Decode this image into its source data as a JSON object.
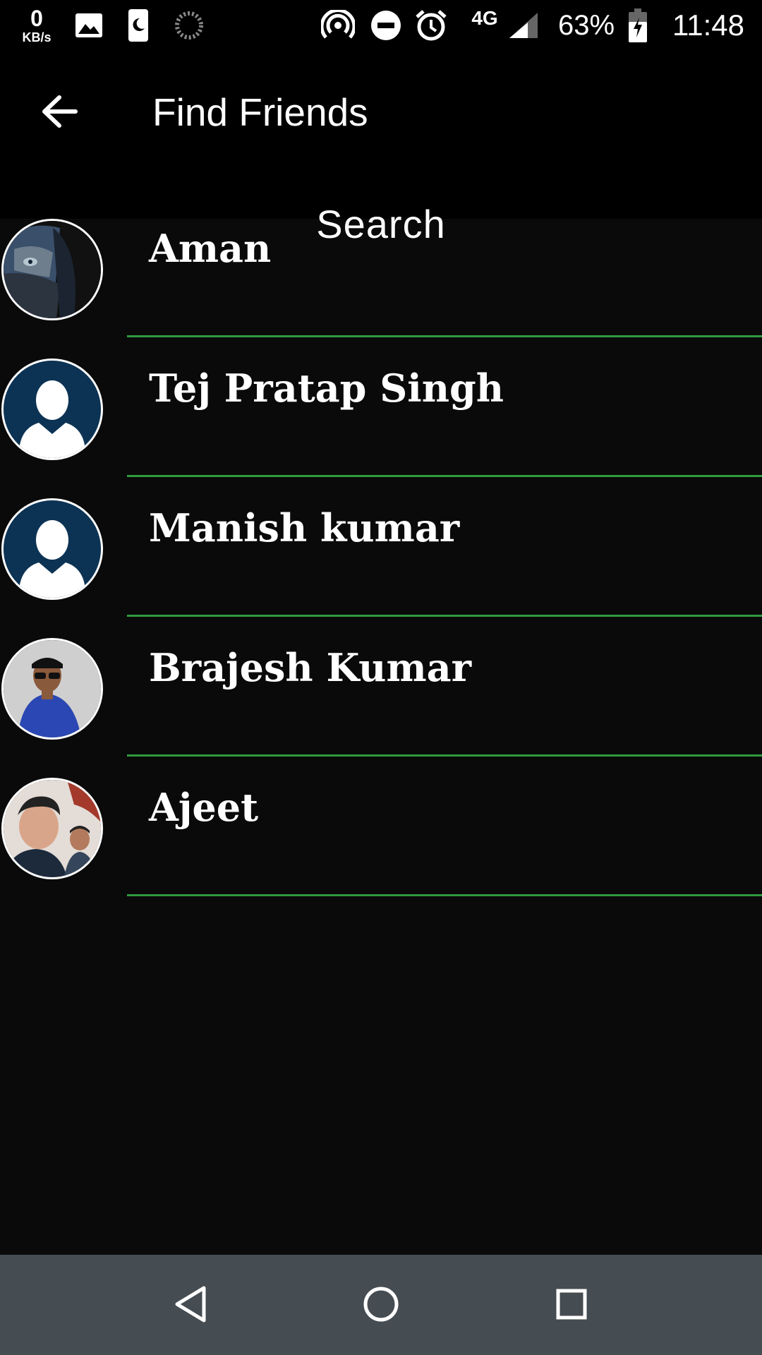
{
  "status_bar": {
    "net_speed_value": "0",
    "net_speed_unit": "KB/s",
    "network": "4G",
    "battery": "63%",
    "time": "11:48",
    "icons": [
      "image-icon",
      "sim-icon",
      "loading-icon",
      "hotspot-icon",
      "dnd-icon",
      "alarm-icon",
      "signal-icon",
      "battery-icon"
    ]
  },
  "toolbar": {
    "back_icon": "arrow-left-icon",
    "title": "Find Friends"
  },
  "search": {
    "label": "Search"
  },
  "friends": [
    {
      "name": "Aman",
      "avatar": "photo-masked-face"
    },
    {
      "name": "Tej Pratap Singh",
      "avatar": "default-user-silhouette"
    },
    {
      "name": "Manish kumar",
      "avatar": "default-user-silhouette"
    },
    {
      "name": "Brajesh Kumar",
      "avatar": "photo-man-cap-sunglasses"
    },
    {
      "name": "Ajeet",
      "avatar": "photo-two-men-selfie"
    }
  ],
  "colors": {
    "background": "#0a0a0a",
    "toolbar": "#000000",
    "divider": "#2f9a3e",
    "avatar_default_bg": "#0c3354",
    "navbar": "#454c52"
  },
  "nav_bar": {
    "icons": [
      "back-triangle-icon",
      "home-circle-icon",
      "recents-square-icon"
    ]
  }
}
